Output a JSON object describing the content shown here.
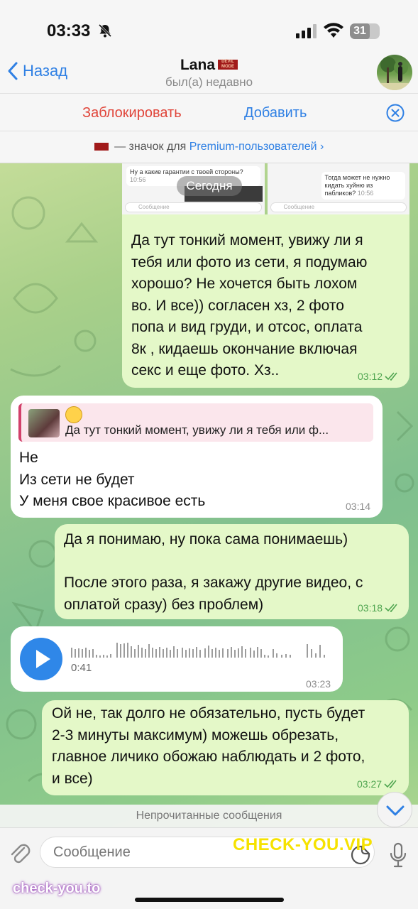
{
  "status_bar": {
    "time": "03:33",
    "battery": "31"
  },
  "header": {
    "back_label": "Назад",
    "contact_name": "Lana",
    "status": "был(а) недавно",
    "block_label": "Заблокировать",
    "add_label": "Добавить",
    "premium_note_prefix": "— значок для",
    "premium_note_link": "Premium-пользователей",
    "premium_chevron": "›"
  },
  "date_divider": "Сегодня",
  "photo_previews": [
    {
      "message": "Ну а какие гарантии с твоей стороны?",
      "time": "10:56",
      "input_placeholder": "Сообщение"
    },
    {
      "message": "Тогда может не нужно кидать хуйню из пабликов?",
      "time": "10:56",
      "input_placeholder": "Сообщение"
    }
  ],
  "messages": [
    {
      "direction": "out",
      "text": "Да тут тонкий момент, увижу ли я\nтебя или фото из сети, я подумаю\nхорошо? Не хочется быть лохом\nво. И все)) согласен хз, 2 фото\nпопа и вид груди, и отсос, оплата\n8к , кидаешь окончание включая\nсекс и еще фото. Хз..",
      "time": "03:12",
      "read": true
    },
    {
      "direction": "in",
      "reply_to": "Да тут тонкий момент, увижу ли я тебя или ф...",
      "text": "Не\nИз сети не будет\nУ меня свое красивое есть",
      "time": "03:14"
    },
    {
      "direction": "out",
      "text": "Да я понимаю, ну пока сама понимаешь)\n\nПосле этого раза, я закажу другие видео, с\nоплатой сразу) без проблем)",
      "time": "03:18",
      "read": true
    },
    {
      "direction": "in",
      "voice_duration": "0:41",
      "time": "03:23"
    },
    {
      "direction": "out",
      "text": "Ой не, так долго не обязательно, пусть будет\n2-3 минуты максимум) можешь обрезать,\nглавное личико обожаю наблюдать и 2 фото,\nи все)",
      "time": "03:27",
      "read": true
    }
  ],
  "unread_label": "Непрочитанные сообщения",
  "input": {
    "placeholder": "Сообщение"
  },
  "watermarks": {
    "top": "CHECK-YOU.VIP",
    "bottom": "check-you.to"
  },
  "colors": {
    "accent": "#2f80e4",
    "danger": "#e0453a",
    "outgoing_bubble": "#e4f8c8",
    "read_check": "#4fa550"
  }
}
